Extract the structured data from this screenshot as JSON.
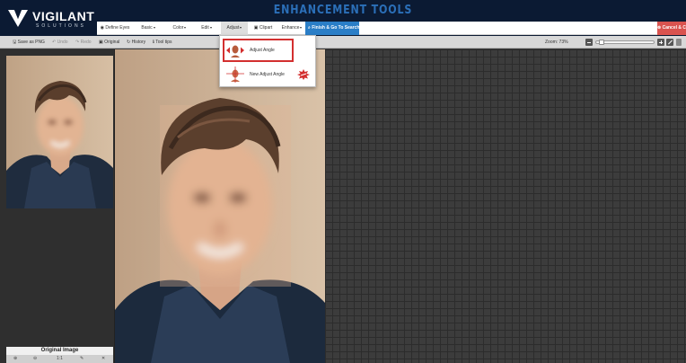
{
  "app": {
    "brand": "VIGILANT",
    "brand_sub": "SOLUTIONS",
    "title": "ENHANCEMENT TOOLS"
  },
  "menu": {
    "define_eyes": "Define Eyes",
    "basic": "Basic",
    "color": "Color",
    "edit": "Edit",
    "adjust": "Adjust",
    "clipart": "Clipart",
    "enhance": "Enhance",
    "finish": "Finish & Go To Search",
    "cancel": "Cancel & C"
  },
  "toolbar": {
    "save_png": "Save as PNG",
    "undo": "Undo",
    "redo": "Redo",
    "original": "Original",
    "history": "History",
    "tool_tips": "Tool tips",
    "zoom_label": "Zoom: 73%",
    "zoom_value": 73
  },
  "adjust_menu": {
    "items": [
      {
        "label": "Adjust Angle"
      },
      {
        "label": "New Adjust Angle"
      }
    ]
  },
  "original_panel": {
    "label": "Original Image",
    "controls": [
      "⊕",
      "⊖",
      "1:1",
      "✎",
      "✕"
    ]
  },
  "colors": {
    "banner_bg": "#0b1a33",
    "title_blue": "#2b6fb8",
    "finish_blue": "#2a7ec7",
    "cancel_red": "#d9534f",
    "highlight_red": "#d32f2f",
    "canvas_bg": "#3c3c3c"
  }
}
